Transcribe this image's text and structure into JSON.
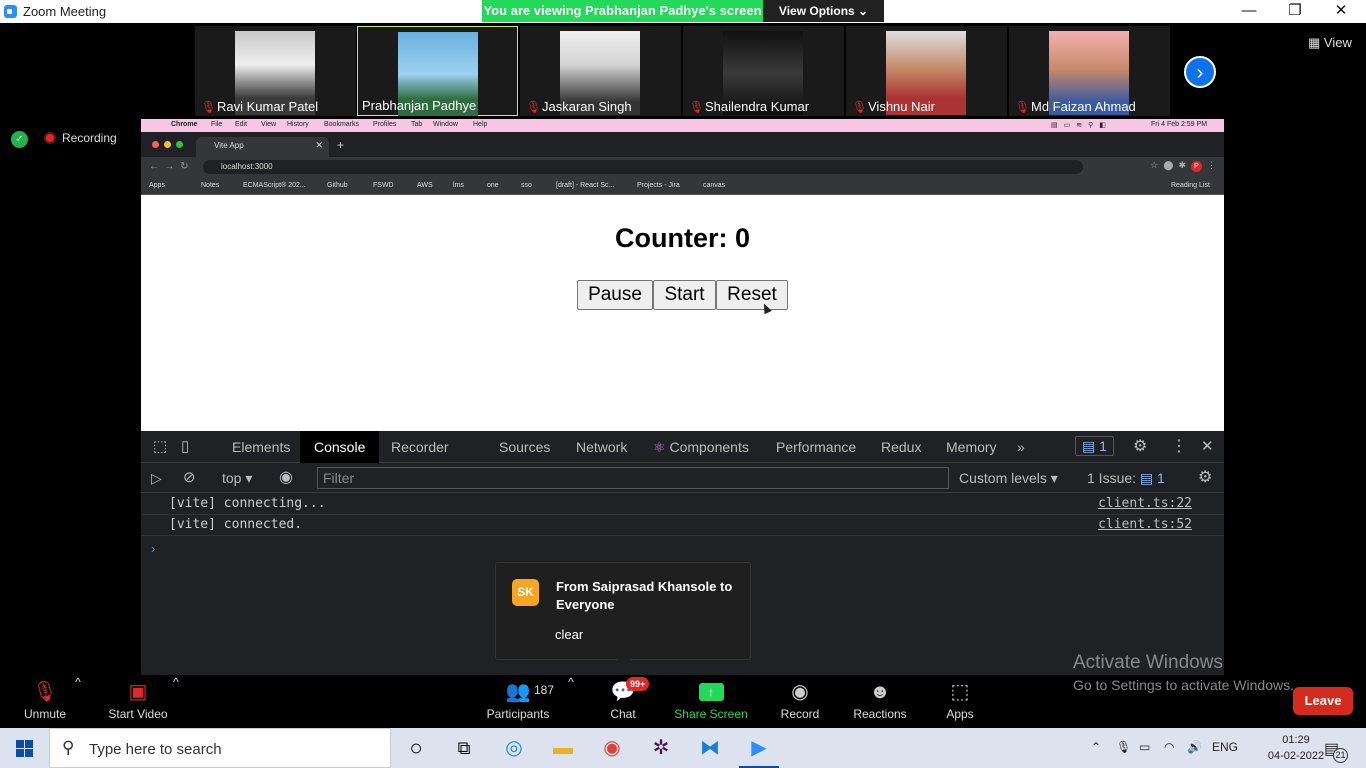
{
  "window": {
    "title": "Zoom Meeting",
    "minimize": "—",
    "maximize": "❐",
    "close": "✕"
  },
  "banner": {
    "viewing": "You are viewing Prabhanjan Padhye's screen",
    "view_options": "View Options ⌄"
  },
  "strip": {
    "view_label": "View",
    "next_icon": "chevron-right-icon",
    "participants": [
      {
        "name": "Ravi Kumar Patel",
        "muted": true,
        "bg": "#c9c9c9"
      },
      {
        "name": "Prabhanjan Padhye",
        "muted": false,
        "bg": "#7fb4d8"
      },
      {
        "name": "Jaskaran Singh",
        "muted": true,
        "bg": "#d4d4d4"
      },
      {
        "name": "Shailendra Kumar",
        "muted": true,
        "bg": "#2a2a2a"
      },
      {
        "name": "Vishnu Nair",
        "muted": true,
        "bg": "#a33"
      },
      {
        "name": "Md Faizan Ahmad",
        "muted": true,
        "bg": "#c88a6a"
      }
    ]
  },
  "recording": {
    "label": "Recording"
  },
  "mac_menu": {
    "items": [
      "Chrome",
      "File",
      "Edit",
      "View",
      "History",
      "Bookmarks",
      "Profiles",
      "Tab",
      "Window",
      "Help"
    ],
    "datetime": "Fri 4 Feb  2:59 PM"
  },
  "browser": {
    "tab_title": "Vite App",
    "url": "localhost:3000",
    "bookmarks": [
      "Apps",
      "Notes",
      "ECMAScript® 202...",
      "Github",
      "FSWD",
      "AWS",
      "lms",
      "one",
      "sso",
      "[draft] - React Sc...",
      "Projects - Jira",
      "canvas"
    ],
    "reading_list": "Reading List",
    "profile_initial": "P"
  },
  "app": {
    "counter_text": "Counter: 0",
    "buttons": {
      "pause": "Pause",
      "start": "Start",
      "reset": "Reset"
    }
  },
  "devtools": {
    "tabs": [
      "Elements",
      "Console",
      "Recorder",
      "Sources",
      "Network",
      "Components",
      "Performance",
      "Redux",
      "Memory"
    ],
    "active_tab": "Console",
    "issues_badge": "1",
    "context": "top",
    "filter_placeholder": "Filter",
    "levels": "Custom levels",
    "issues_label": "1 Issue:",
    "issues_count": "1",
    "logs": [
      {
        "msg": "[vite] connecting...",
        "src": "client.ts:22"
      },
      {
        "msg": "[vite] connected.",
        "src": "client.ts:52"
      }
    ]
  },
  "chat_popup": {
    "initials": "SK",
    "from": "From Saiprasad Khansole to Everyone",
    "message": "clear"
  },
  "watermark": {
    "line1": "Activate Windows",
    "line2": "Go to Settings to activate Windows."
  },
  "toolbar": {
    "unmute": "Unmute",
    "start_video": "Start Video",
    "participants": "Participants",
    "participants_count": "187",
    "chat": "Chat",
    "chat_badge": "99+",
    "share": "Share Screen",
    "record": "Record",
    "reactions": "Reactions",
    "apps": "Apps",
    "leave": "Leave"
  },
  "taskbar": {
    "search_placeholder": "Type here to search",
    "language": "ENG",
    "time": "01:29",
    "date": "04-02-2022",
    "notifications": "21"
  },
  "colors": {
    "zoom_green": "#23d959",
    "zoom_blue": "#0e72ed",
    "leave_red": "#d52b1e",
    "mac_menu_pink": "#f7c6e3"
  }
}
